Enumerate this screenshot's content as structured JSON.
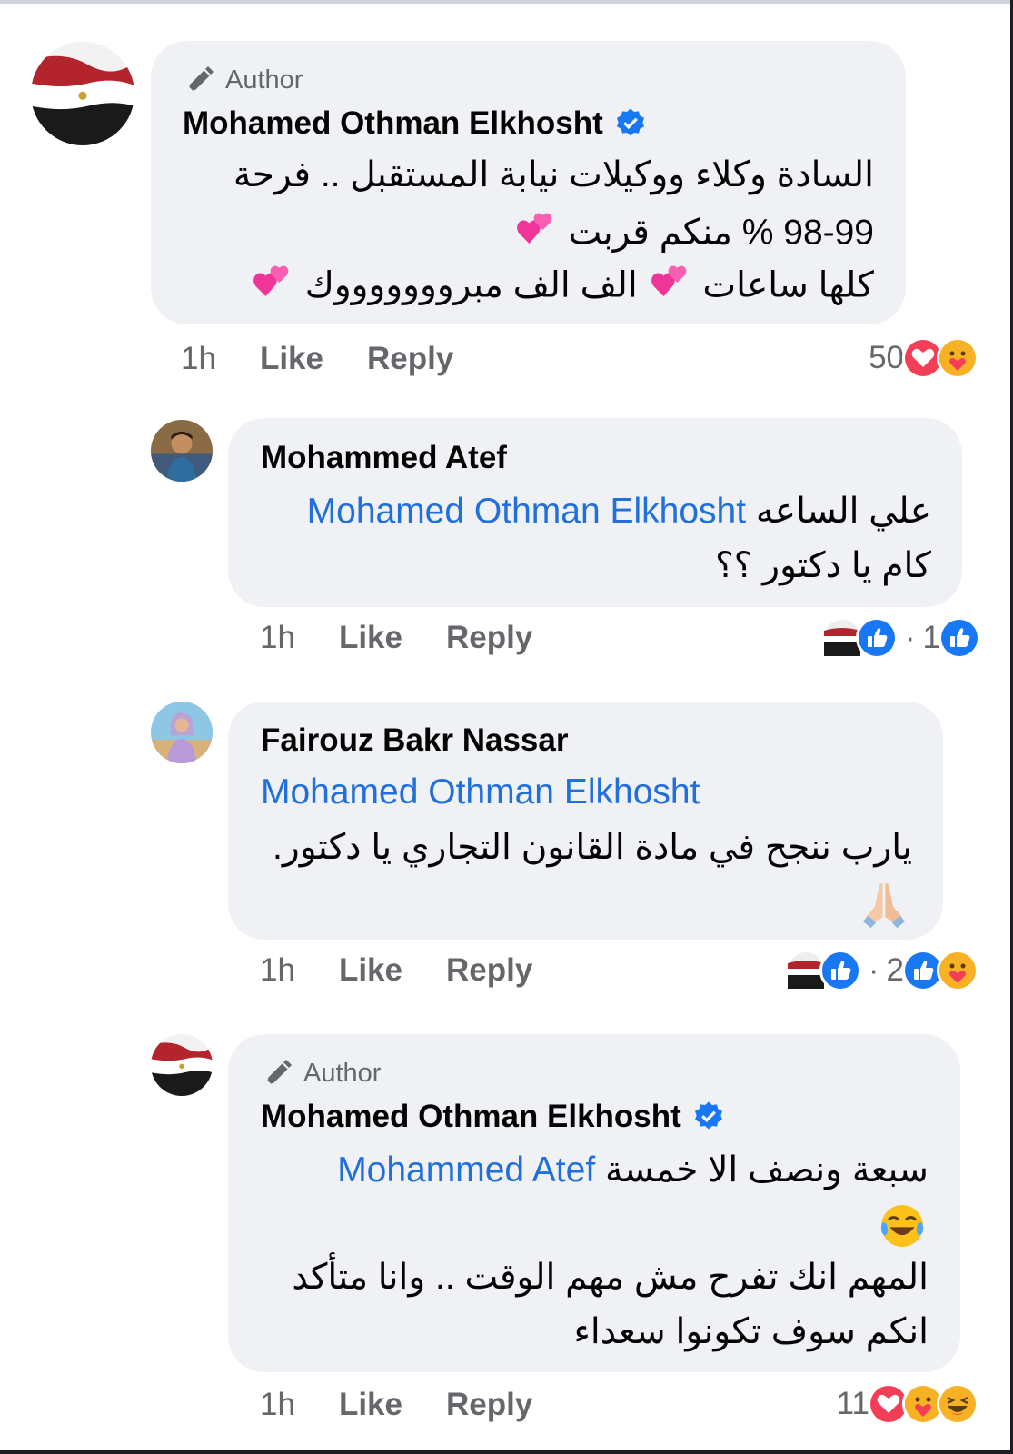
{
  "comments": [
    {
      "author_badge": "Author",
      "name": "Mohamed Othman Elkhosht",
      "lines": [
        "السادة وكلاء ووكيلات نيابة المستقبل  ..  فرحة",
        "98-99 % منكم قربت",
        "كلها ساعات",
        "الف الف مبروووووووك"
      ],
      "time": "1h",
      "like": "Like",
      "reply": "Reply",
      "reaction_count": "50",
      "reactions": [
        "love-icon",
        "care-icon"
      ]
    },
    {
      "name": "Mohammed Atef",
      "mention": "Mohamed Othman Elkhosht",
      "line1_text": "علي الساعه",
      "line2": "كام يا دكتور ؟؟",
      "time": "1h",
      "like": "Like",
      "reply": "Reply",
      "reaction_count": "1",
      "reactions": [
        "like-icon"
      ]
    },
    {
      "name": "Fairouz Bakr Nassar",
      "mention": "Mohamed Othman Elkhosht",
      "line1": "يارب ننجح في مادة القانون التجاري يا دكتور.",
      "time": "1h",
      "like": "Like",
      "reply": "Reply",
      "reaction_count": "2",
      "reactions": [
        "like-icon",
        "care-icon"
      ]
    },
    {
      "author_badge": "Author",
      "name": "Mohamed Othman Elkhosht",
      "mention": "Mohammed Atef",
      "line1_text": "سبعة ونصف الا خمسة",
      "line3": "المهم انك تفرح مش مهم الوقت .. وانا متأكد",
      "line4": "انكم سوف تكونوا سعداء",
      "time": "1h",
      "like": "Like",
      "reply": "Reply",
      "reaction_count": "11",
      "reactions": [
        "love-icon",
        "care-icon",
        "haha-icon"
      ]
    }
  ],
  "colors": {
    "bubble": "#eff1f4",
    "mention": "#216fdb",
    "meta": "#65676b",
    "like_blue": "#1877f2",
    "love_red": "#f33e58"
  }
}
